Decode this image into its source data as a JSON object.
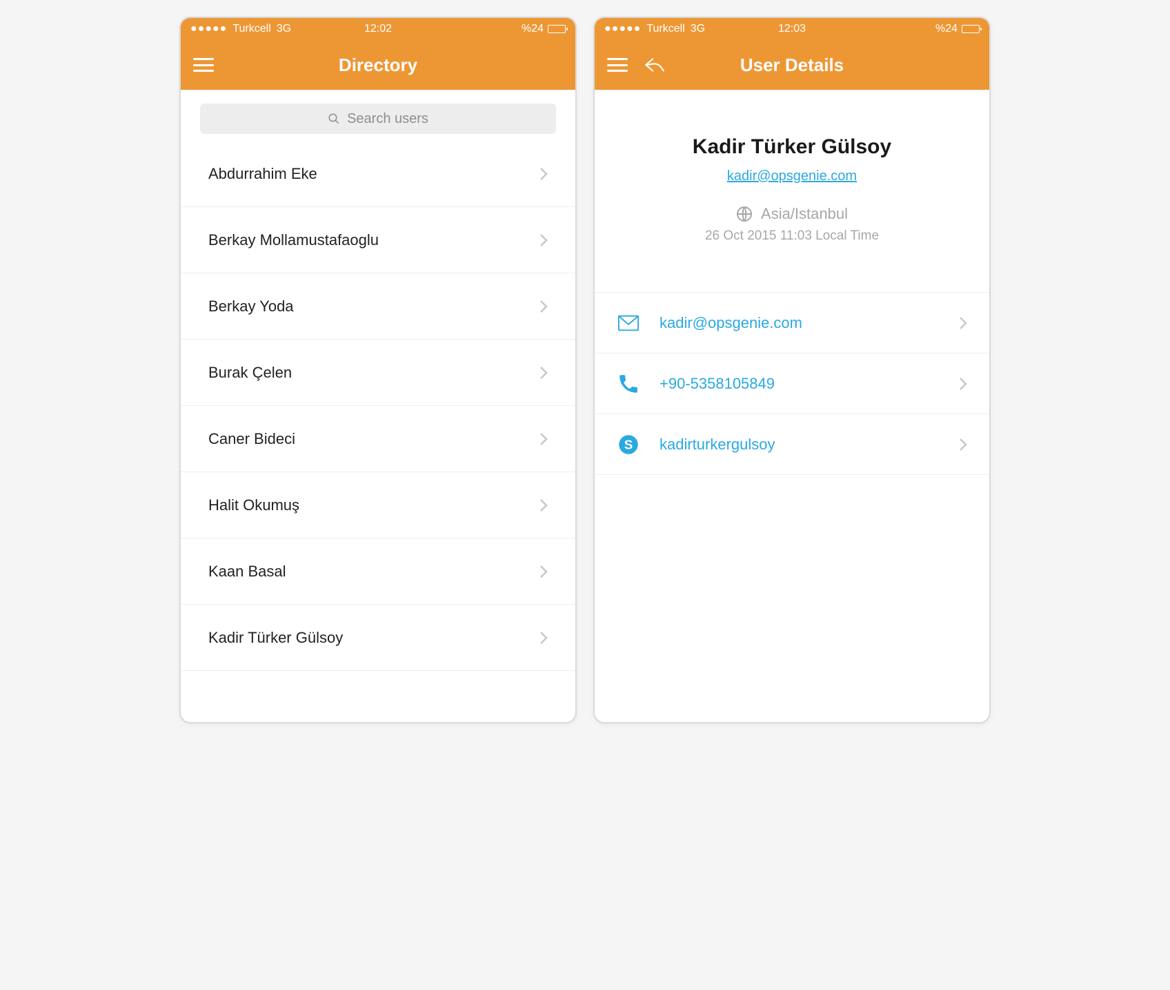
{
  "statusbar": {
    "carrier": "Turkcell",
    "network": "3G",
    "time_left": "12:02",
    "time_right": "12:03",
    "battery": "%24"
  },
  "directory": {
    "title": "Directory",
    "search_placeholder": "Search users",
    "users": [
      {
        "name": "Abdurrahim Eke"
      },
      {
        "name": "Berkay Mollamustafaoglu"
      },
      {
        "name": "Berkay Yoda"
      },
      {
        "name": "Burak Çelen"
      },
      {
        "name": "Caner Bideci"
      },
      {
        "name": "Halit Okumuş"
      },
      {
        "name": "Kaan Basal"
      },
      {
        "name": "Kadir Türker Gülsoy"
      }
    ]
  },
  "details": {
    "title": "User Details",
    "name": "Kadir Türker Gülsoy",
    "email": "kadir@opsgenie.com",
    "timezone": "Asia/Istanbul",
    "local_time": "26 Oct 2015 11:03 Local Time",
    "contacts": {
      "email": "kadir@opsgenie.com",
      "phone": "+90-5358105849",
      "skype": "kadirturkergulsoy"
    }
  }
}
